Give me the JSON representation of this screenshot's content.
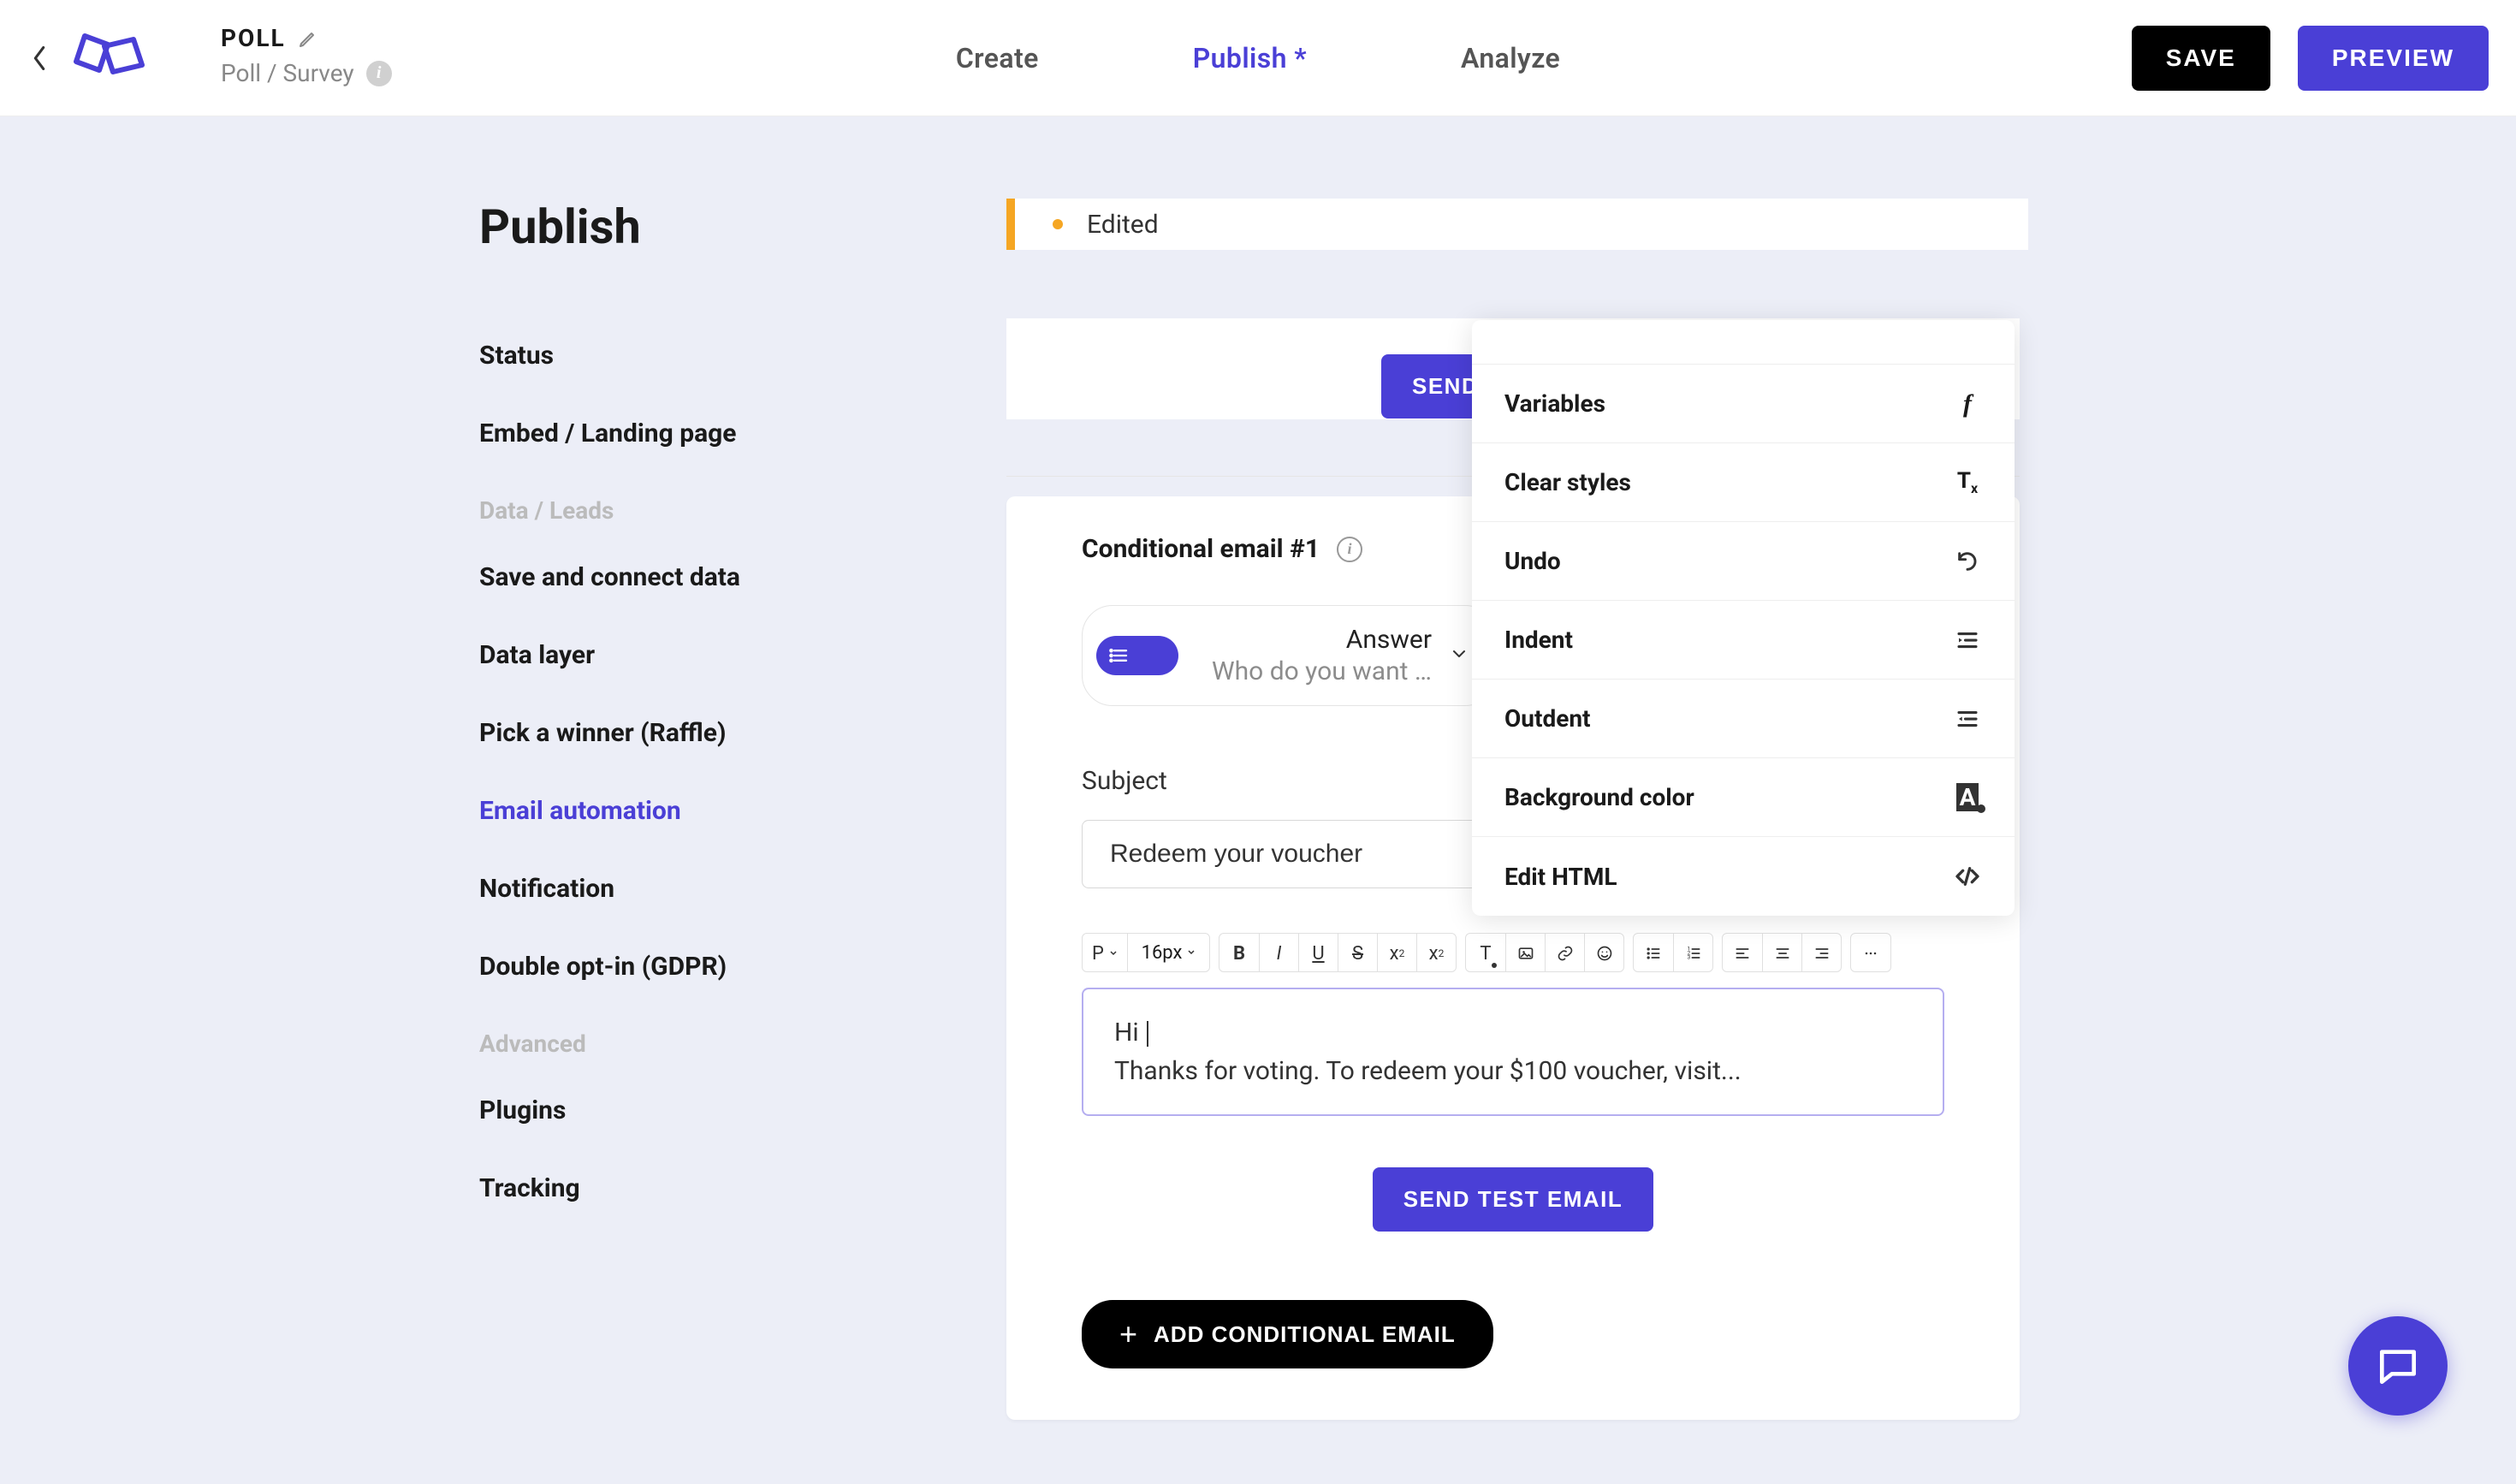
{
  "header": {
    "title": "POLL",
    "subtitle": "Poll / Survey",
    "tabs": {
      "create": "Create",
      "publish": "Publish *",
      "analyze": "Analyze"
    },
    "save": "SAVE",
    "preview": "PREVIEW"
  },
  "sidebar": {
    "page_title": "Publish",
    "status": "Status",
    "embed": "Embed / Landing page",
    "cat_data": "Data / Leads",
    "save_connect": "Save and connect data",
    "data_layer": "Data layer",
    "raffle": "Pick a winner (Raffle)",
    "email_auto": "Email automation",
    "notification": "Notification",
    "gdpr": "Double opt-in (GDPR)",
    "cat_adv": "Advanced",
    "plugins": "Plugins",
    "tracking": "Tracking"
  },
  "status": {
    "text": "Edited"
  },
  "send_test_top": "SEND TEST EMAIL",
  "cond": {
    "title": "Conditional email #1",
    "answer_label": "Answer",
    "answer_sub": "Who do you want …"
  },
  "subject": {
    "label": "Subject",
    "value": "Redeem your voucher"
  },
  "toolbar": {
    "para": "P",
    "fontsize": "16px"
  },
  "editor": {
    "line1_pre": "Hi ",
    "line2": "Thanks for voting. To redeem your $100 voucher, visit..."
  },
  "send_test_bottom": "SEND TEST EMAIL",
  "add_cond": "ADD CONDITIONAL EMAIL",
  "dropdown": {
    "variables": "Variables",
    "clear_styles": "Clear styles",
    "undo": "Undo",
    "indent": "Indent",
    "outdent": "Outdent",
    "bgcolor": "Background color",
    "edit_html": "Edit HTML"
  }
}
